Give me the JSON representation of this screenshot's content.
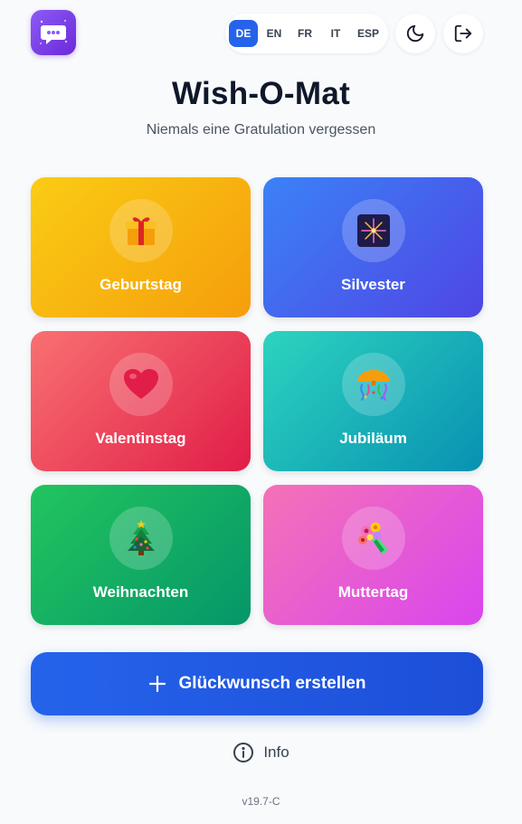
{
  "header": {
    "logo_icon": "chat-bubble-icon",
    "languages": [
      {
        "label": "DE",
        "active": true
      },
      {
        "label": "EN",
        "active": false
      },
      {
        "label": "FR",
        "active": false
      },
      {
        "label": "IT",
        "active": false
      },
      {
        "label": "ESP",
        "active": false
      }
    ],
    "theme_icon": "moon-icon",
    "logout_icon": "logout-icon"
  },
  "title": "Wish-O-Mat",
  "subtitle": "Niemals eine Gratulation vergessen",
  "occasions": [
    {
      "label": "Geburtstag",
      "icon": "gift-icon",
      "emoji": "🎁",
      "color": "#f59e0b"
    },
    {
      "label": "Silvester",
      "icon": "fireworks-icon",
      "emoji": "🎆",
      "color": "#4f46e5"
    },
    {
      "label": "Valentinstag",
      "icon": "heart-icon",
      "emoji": "❤️",
      "color": "#e11d48"
    },
    {
      "label": "Jubiläum",
      "icon": "confetti-icon",
      "emoji": "🎊",
      "color": "#0891b2"
    },
    {
      "label": "Weihnachten",
      "icon": "christmas-tree-icon",
      "emoji": "🎄",
      "color": "#059669"
    },
    {
      "label": "Muttertag",
      "icon": "bouquet-icon",
      "emoji": "💐",
      "color": "#d946ef"
    }
  ],
  "create_button": {
    "label": "Glückwunsch erstellen",
    "icon": "plus-icon"
  },
  "info": {
    "label": "Info",
    "icon": "info-icon"
  },
  "version": "v19.7-C"
}
